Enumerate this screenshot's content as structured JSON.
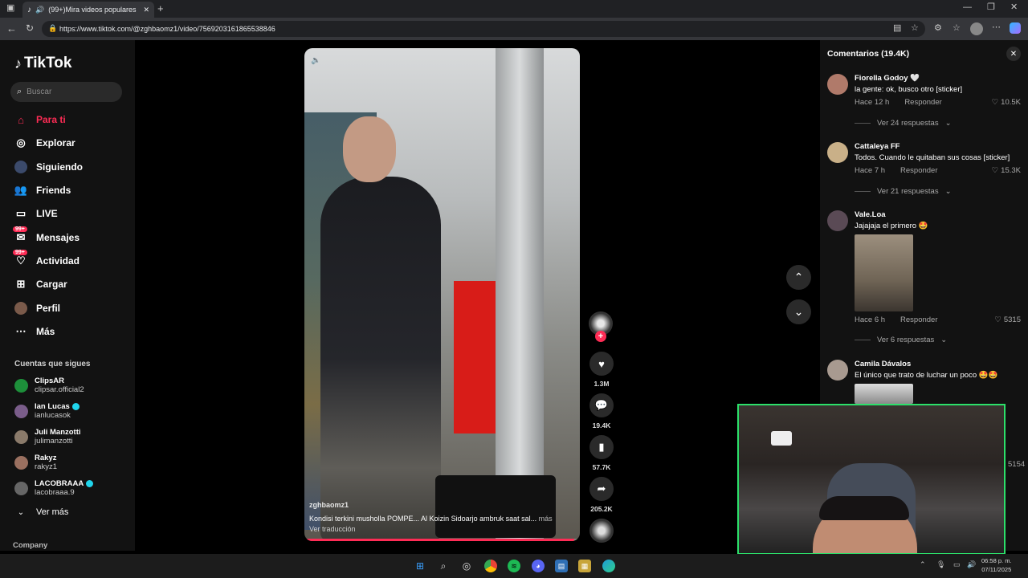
{
  "browser": {
    "tab_title": "(99+)Mira videos populares",
    "url": "https://www.tiktok.com/@zghbaomz1/video/7569203161865538846"
  },
  "sidebar": {
    "logo": "TikTok",
    "search_placeholder": "Buscar",
    "nav": [
      {
        "label": "Para ti",
        "icon": "home-icon"
      },
      {
        "label": "Explorar",
        "icon": "compass-icon"
      },
      {
        "label": "Siguiendo",
        "icon": "following-avatar-icon"
      },
      {
        "label": "Friends",
        "icon": "friends-icon"
      },
      {
        "label": "LIVE",
        "icon": "live-tv-icon"
      },
      {
        "label": "Mensajes",
        "icon": "messages-icon",
        "badge": "99+"
      },
      {
        "label": "Actividad",
        "icon": "activity-icon",
        "badge": "99+"
      },
      {
        "label": "Cargar",
        "icon": "upload-icon"
      },
      {
        "label": "Perfil",
        "icon": "profile-avatar-icon"
      },
      {
        "label": "Más",
        "icon": "more-dots-icon"
      }
    ],
    "following_title": "Cuentas que sigues",
    "following": [
      {
        "name": "ClipsAR",
        "handle": "clipsar.official2",
        "verified": false
      },
      {
        "name": "Ian Lucas",
        "handle": "ianlucasok",
        "verified": true
      },
      {
        "name": "Juli Manzotti",
        "handle": "julimanzotti",
        "verified": false
      },
      {
        "name": "Rakyz",
        "handle": "rakyz1",
        "verified": false
      },
      {
        "name": "LACOBRAAA",
        "handle": "lacobraaa.9",
        "verified": true
      }
    ],
    "see_more": "Ver más",
    "company": "Company"
  },
  "video": {
    "username": "zghbaomz1",
    "description": "Kondisi terkini musholla POMPE... Al Koizin Sidoarjo ambruk saat sal...",
    "more": "más",
    "translate": "Ver traducción",
    "progress": 0.98
  },
  "actions": {
    "likes": "1.3M",
    "comments": "19.4K",
    "saves": "57.7K",
    "shares": "205.2K"
  },
  "comments_panel": {
    "title": "Comentarios (19.4K)",
    "reply_label": "Responder",
    "items": [
      {
        "name": "Fiorella Godoy 🤍",
        "text": "la gente: ok, busco otro [sticker]",
        "time": "Hace 12 h",
        "likes": "10.5K",
        "replies": "Ver 24 respuestas"
      },
      {
        "name": "Cattaleya FF",
        "text": "Todos. Cuando le quitaban sus cosas [sticker]",
        "time": "Hace 7 h",
        "likes": "15.3K",
        "replies": "Ver 21 respuestas"
      },
      {
        "name": "Vale.Loa",
        "text": "Jajajaja el primero 🤩",
        "time": "Hace 6 h",
        "likes": "5315",
        "replies": "Ver 6 respuestas"
      },
      {
        "name": "Camila Dávalos",
        "text": "El único que trato de luchar un poco 🤩🤩",
        "time": "",
        "likes": "5154",
        "replies": ""
      }
    ]
  },
  "taskbar": {
    "time": "06:58 p. m.",
    "date": "07/11/2025"
  },
  "colors": {
    "accent": "#fe2c55",
    "panel": "#121212",
    "cam_border": "#2ce06a"
  }
}
